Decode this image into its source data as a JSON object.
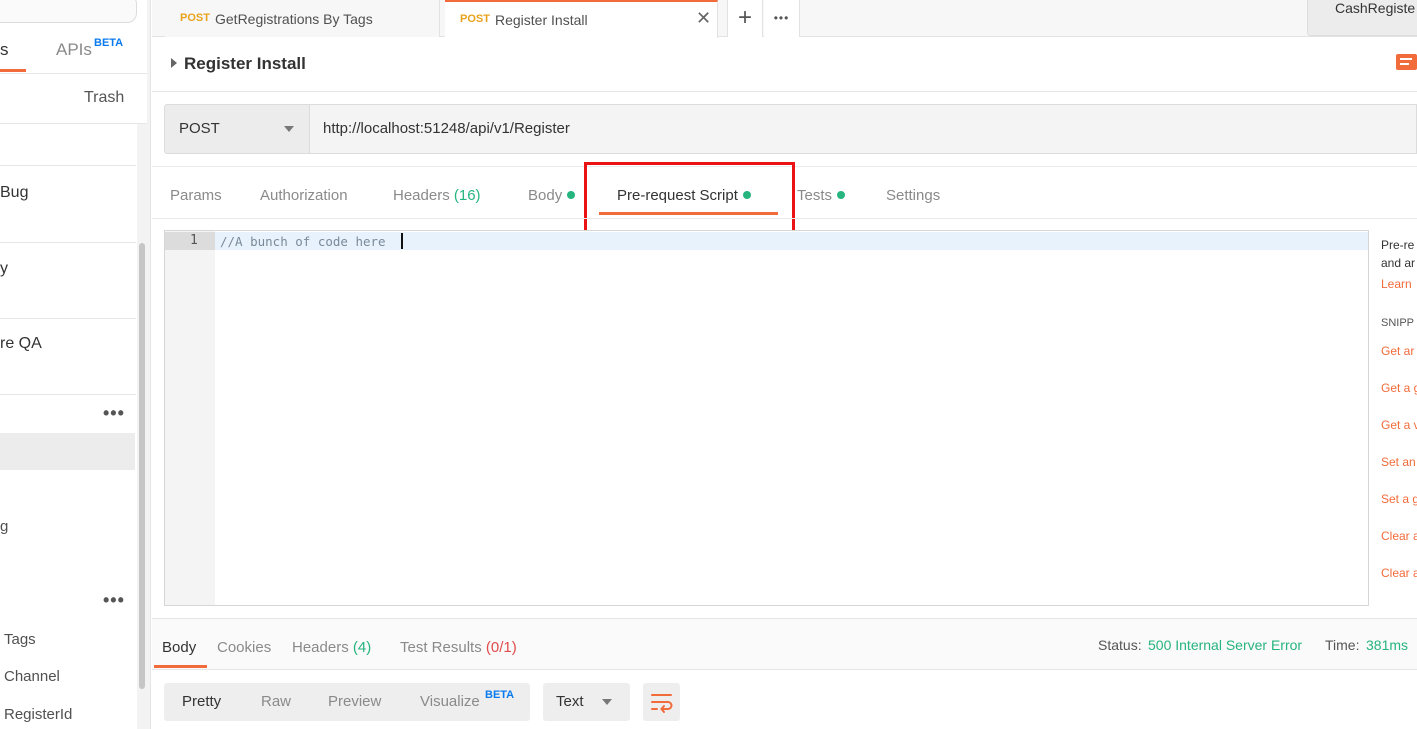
{
  "sidebar": {
    "tab_fragment": "s",
    "apis_label": "APIs",
    "apis_badge": "BETA",
    "trash_label": "Trash",
    "collections": [
      "Bug",
      "y",
      "re QA"
    ],
    "more_glyph": "•••",
    "requests": [
      "g",
      "Tags",
      "Channel",
      "RegisterId"
    ]
  },
  "tabs": [
    {
      "method": "POST",
      "name": "GetRegistrations By Tags"
    },
    {
      "method": "POST",
      "name": "Register Install",
      "active": true
    }
  ],
  "tabbar": {
    "add_glyph": "+",
    "more_glyph": "•••",
    "close_glyph": "✕",
    "environment": "CashRegiste"
  },
  "request": {
    "title": "Register Install",
    "method": "POST",
    "url": "http://localhost:51248/api/v1/Register"
  },
  "request_tabs": {
    "params": "Params",
    "authorization": "Authorization",
    "headers": "Headers",
    "headers_count": "(16)",
    "body": "Body",
    "prerequest": "Pre-request Script",
    "tests": "Tests",
    "settings": "Settings"
  },
  "editor": {
    "line_number": "1",
    "code": "//A bunch of code here"
  },
  "snippets": {
    "desc_1": "Pre-re",
    "desc_2": "and ar",
    "learn": "Learn",
    "heading": "SNIPP",
    "items": [
      "Get ar",
      "Get a g",
      "Get a v",
      "Set an",
      "Set a g",
      "Clear a",
      "Clear a"
    ]
  },
  "response": {
    "tabs": {
      "body": "Body",
      "cookies": "Cookies",
      "headers": "Headers",
      "headers_count": "(4)",
      "test_results": "Test Results",
      "test_results_count": "(0/1)"
    },
    "status_label": "Status:",
    "status_value": "500 Internal Server Error",
    "time_label": "Time:",
    "time_value": "381ms",
    "format": {
      "pretty": "Pretty",
      "raw": "Raw",
      "preview": "Preview",
      "visualize": "Visualize",
      "visualize_badge": "BETA",
      "type": "Text"
    }
  },
  "colors": {
    "accent": "#f26b3a",
    "success": "#26b47f",
    "error": "#e04b4b",
    "beta": "#097bed",
    "method_post": "#e8a31c",
    "highlight": "#ea1212"
  }
}
